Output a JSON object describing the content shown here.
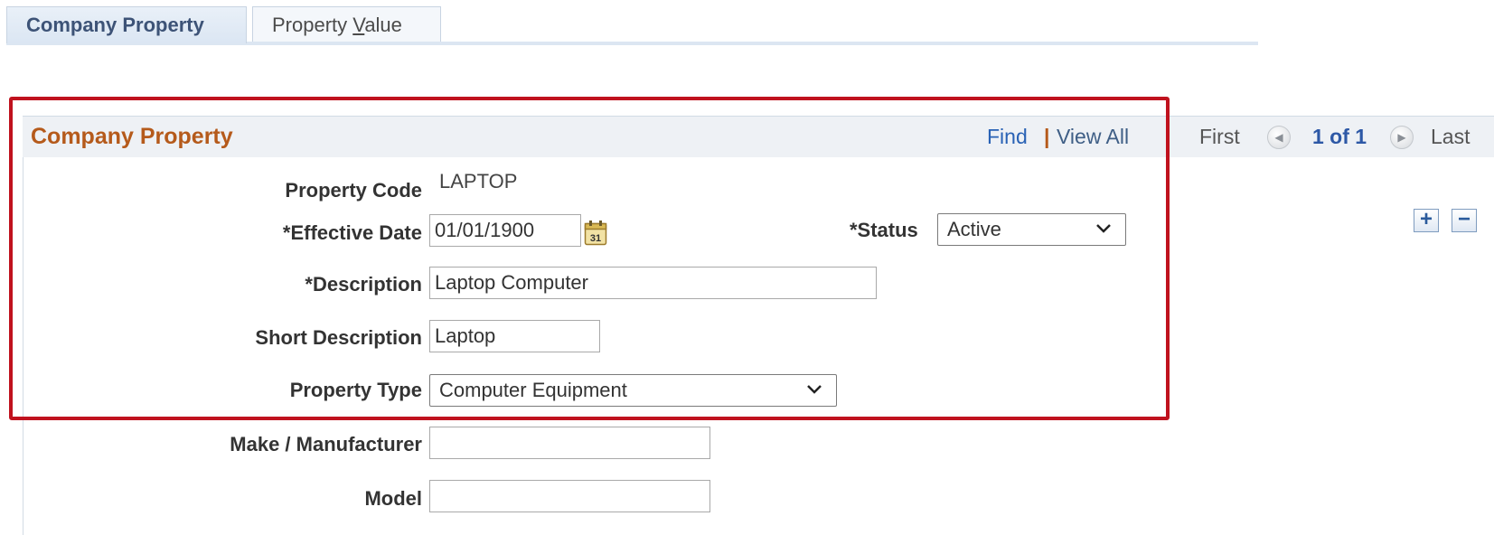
{
  "tabs": [
    {
      "label": "Company Property",
      "active": true
    },
    {
      "label_prefix": "Property ",
      "label_accel": "V",
      "label_suffix": "alue",
      "active": false
    }
  ],
  "panel": {
    "title": "Company Property",
    "find": "Find",
    "separator": "|",
    "view_all": "View All",
    "first": "First",
    "count": "1 of 1",
    "last": "Last"
  },
  "row_buttons": {
    "add": "+",
    "remove": "−"
  },
  "form": {
    "property_code": {
      "label": "Property Code",
      "value": "LAPTOP"
    },
    "effective_date": {
      "label": "*Effective Date",
      "value": "01/01/1900",
      "calendar_icon_text": "31"
    },
    "status": {
      "label": "*Status",
      "value": "Active"
    },
    "description": {
      "label": "*Description",
      "value": "Laptop Computer"
    },
    "short_description": {
      "label": "Short Description",
      "value": "Laptop"
    },
    "property_type": {
      "label": "Property Type",
      "value": "Computer Equipment"
    },
    "make": {
      "label": "Make / Manufacturer",
      "value": ""
    },
    "model": {
      "label": "Model",
      "value": ""
    }
  },
  "colors": {
    "title": "#b55a1b",
    "link": "#2962b5",
    "highlight": "#c0121e",
    "tab_active_text": "#3d5377"
  },
  "icons": {
    "calendar": "calendar-icon",
    "select_arrow": "chevron-down-icon",
    "prev": "previous-arrow-icon",
    "next": "next-arrow-icon"
  }
}
